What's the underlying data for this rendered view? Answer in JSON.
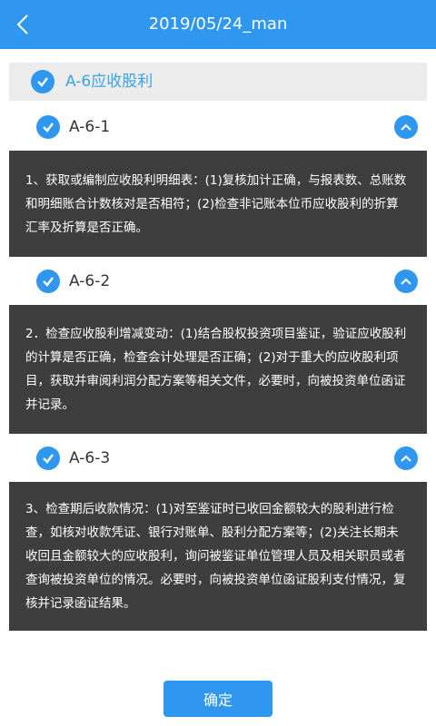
{
  "header": {
    "title": "2019/05/24_man",
    "back_icon": "chevron-left-icon"
  },
  "group": {
    "label": "A-6应收股利",
    "checked": true
  },
  "items": [
    {
      "label": "A-6-1",
      "checked": true,
      "expanded": true,
      "description": "1、获取或编制应收股利明细表：(1)复核加计正确，与报表数、总账数和明细账合计数核对是否相符；(2)检查非记账本位币应收股利的折算汇率及折算是否正确。"
    },
    {
      "label": "A-6-2",
      "checked": true,
      "expanded": true,
      "description": "2．检查应收股利增减变动：(1)结合股权投资项目鉴证，验证应收股利的计算是否正确，检查会计处理是否正确；(2)对于重大的应收股利项目，获取并审阅利润分配方案等相关文件，必要时，向被投资单位函证并记录。"
    },
    {
      "label": "A-6-3",
      "checked": true,
      "expanded": true,
      "description": "3、检查期后收款情况：(1)对至鉴证时已收回金额较大的股利进行检查，如核对收款凭证、银行对账单、股利分配方案等；(2)关注长期未收回且金额较大的应收股利，询问被鉴证单位管理人员及相关职员或者查询被投资单位的情况。必要时，向被投资单位函证股利支付情况，复核并记录函证结果。"
    }
  ],
  "footer": {
    "confirm_label": "确定"
  },
  "colors": {
    "accent": "#2f97f0",
    "description_bg": "#3e3e3e",
    "group_bg": "#ececec"
  }
}
